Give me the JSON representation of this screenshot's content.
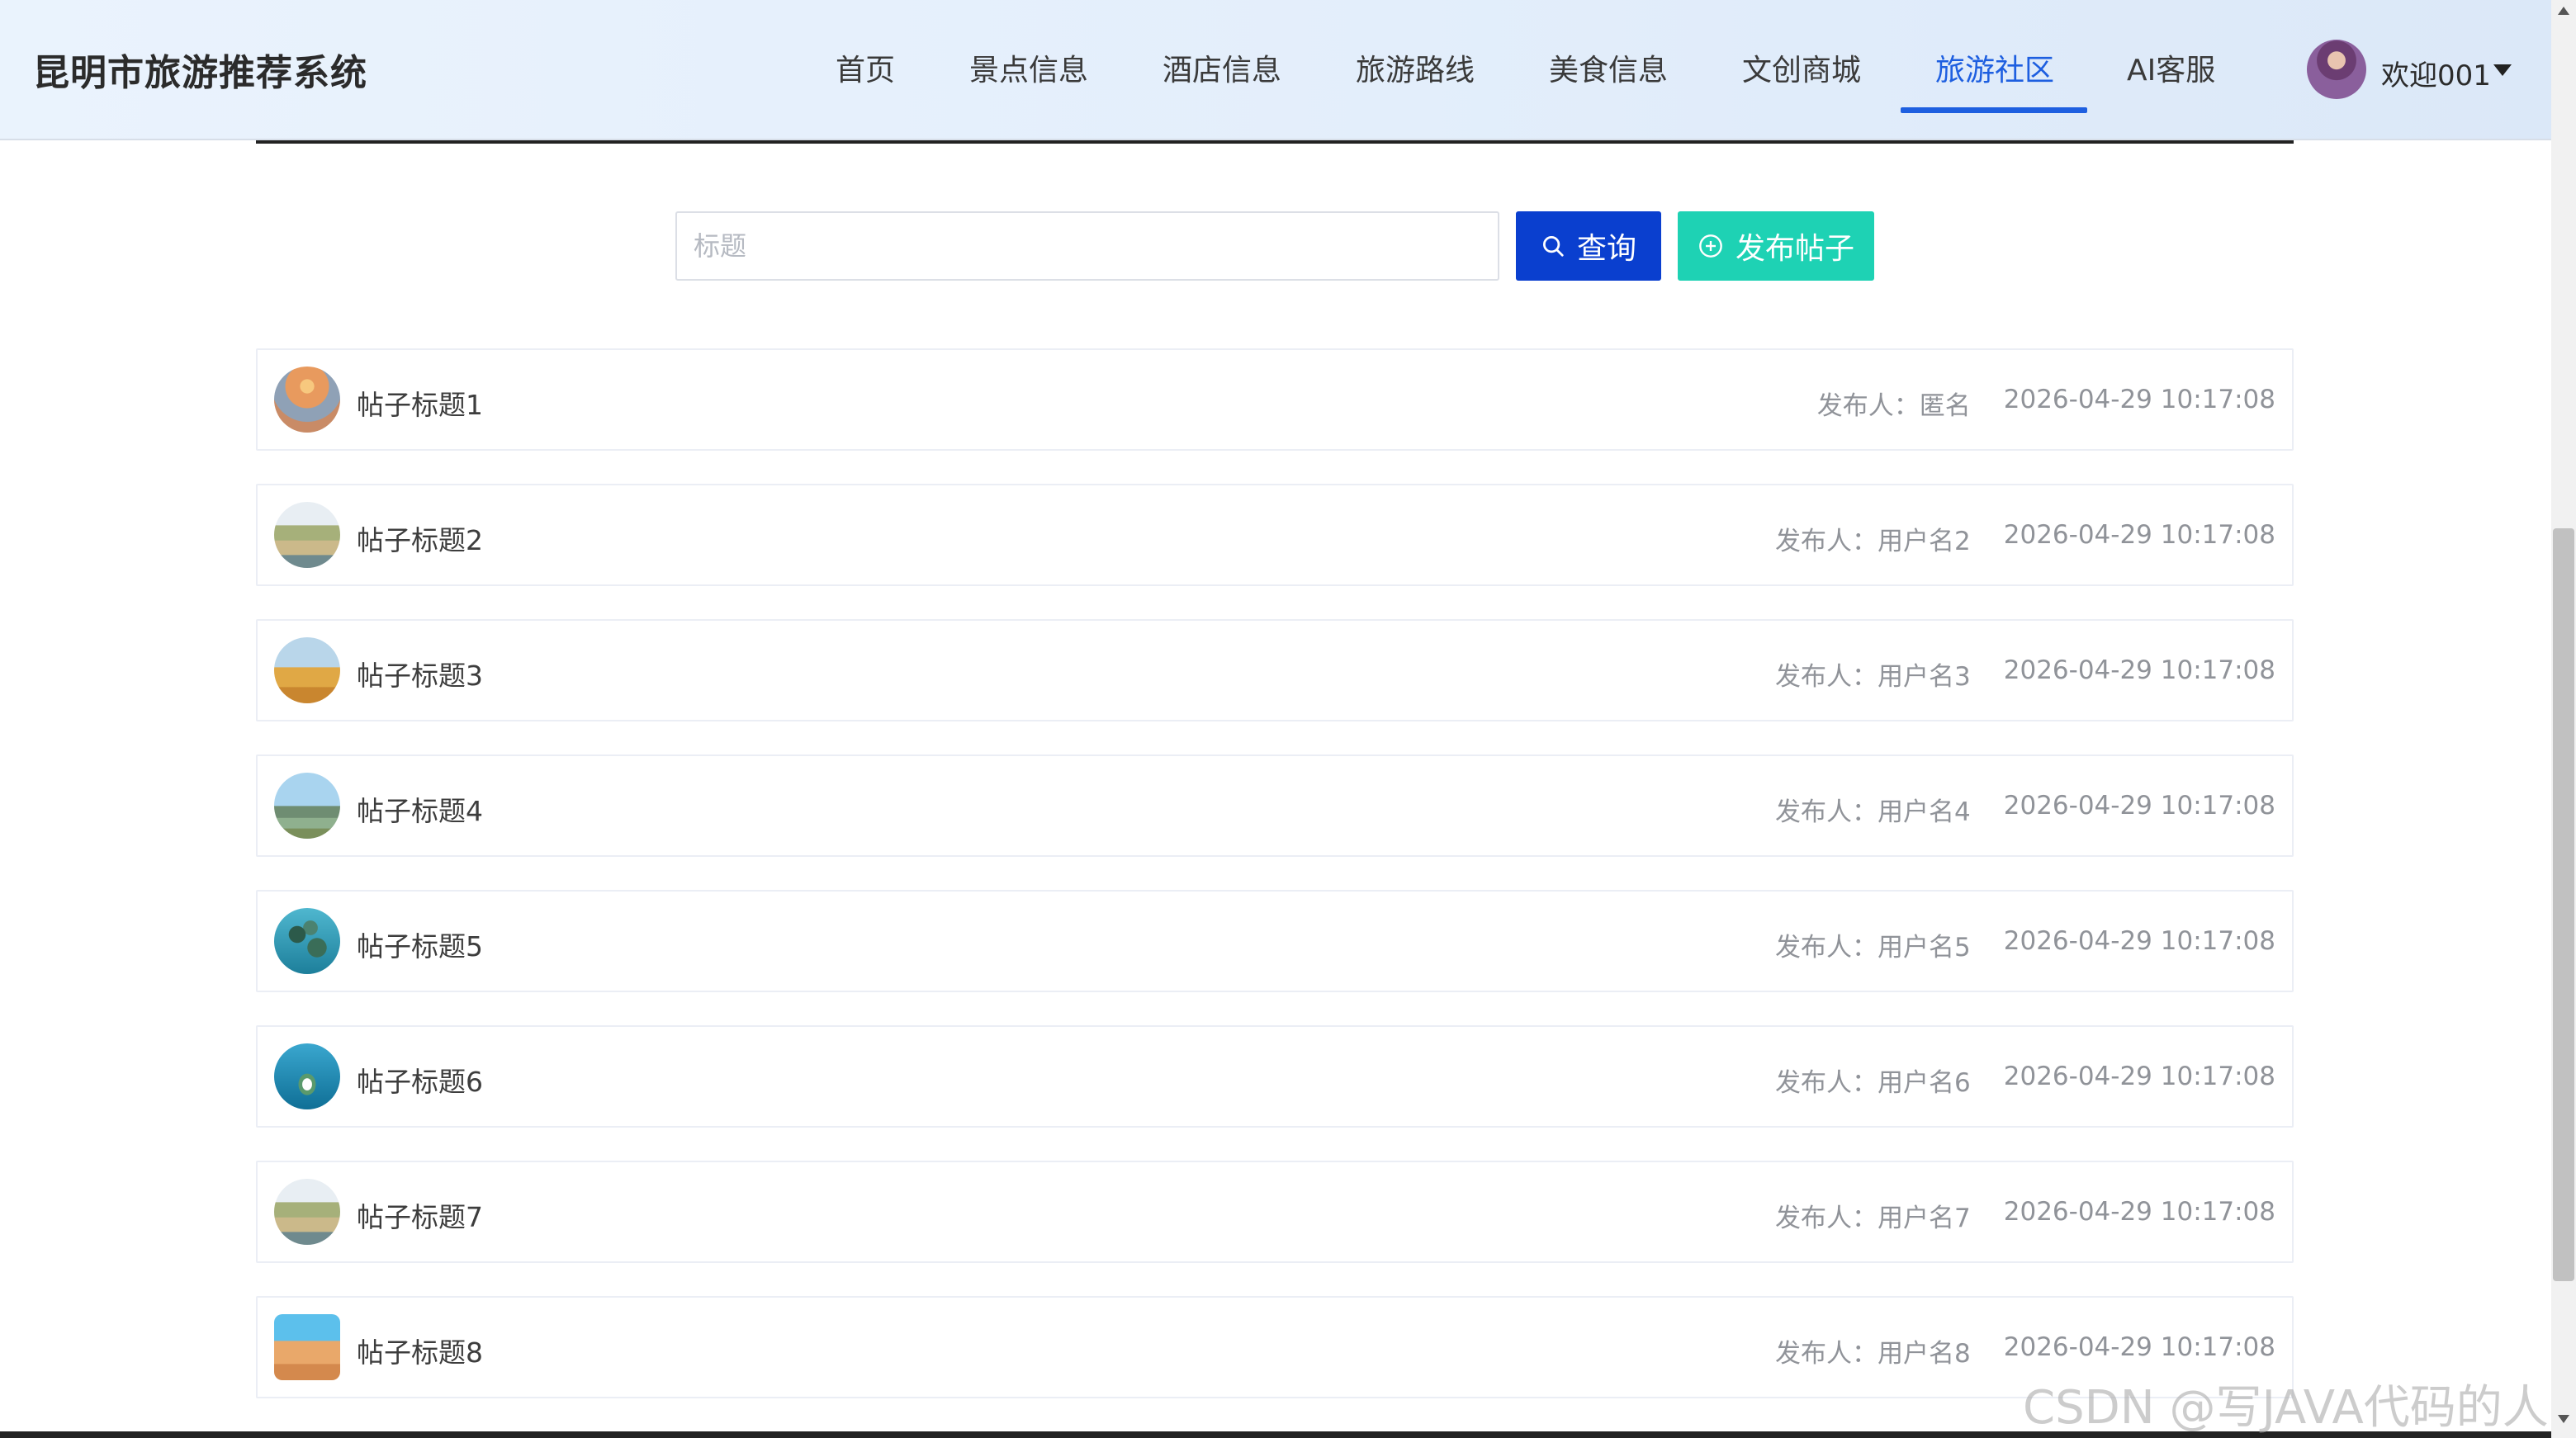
{
  "header": {
    "brand": "昆明市旅游推荐系统",
    "nav": [
      {
        "label": "首页"
      },
      {
        "label": "景点信息"
      },
      {
        "label": "酒店信息"
      },
      {
        "label": "旅游路线"
      },
      {
        "label": "美食信息"
      },
      {
        "label": "文创商城"
      },
      {
        "label": "旅游社区"
      },
      {
        "label": "AI客服"
      }
    ],
    "active_nav": "旅游社区",
    "user": {
      "welcome": "欢迎001",
      "avatar_icon": "user-avatar"
    }
  },
  "search": {
    "placeholder": "标题",
    "value": "",
    "query_label": "查询",
    "post_label": "发布帖子"
  },
  "colors": {
    "accent": "#1e5fe0",
    "query_button": "#0a3fcf",
    "post_button": "#1ed2b4"
  },
  "posts": [
    {
      "title": "帖子标题1",
      "author": "发布人：匿名",
      "time": "2026-04-29 10:17:08",
      "thumb": "sunset-beach"
    },
    {
      "title": "帖子标题2",
      "author": "发布人：用户名2",
      "time": "2026-04-29 10:17:08",
      "thumb": "wetland"
    },
    {
      "title": "帖子标题3",
      "author": "发布人：用户名3",
      "time": "2026-04-29 10:17:08",
      "thumb": "windmill-field"
    },
    {
      "title": "帖子标题4",
      "author": "发布人：用户名4",
      "time": "2026-04-29 10:17:08",
      "thumb": "mountain-lake"
    },
    {
      "title": "帖子标题5",
      "author": "发布人：用户名5",
      "time": "2026-04-29 10:17:08",
      "thumb": "coral-reef"
    },
    {
      "title": "帖子标题6",
      "author": "发布人：用户名6",
      "time": "2026-04-29 10:17:08",
      "thumb": "ocean-island"
    },
    {
      "title": "帖子标题7",
      "author": "发布人：用户名7",
      "time": "2026-04-29 10:17:08",
      "thumb": "wetland"
    },
    {
      "title": "帖子标题8",
      "author": "发布人：用户名8",
      "time": "2026-04-29 10:17:08",
      "thumb": "desert-beach"
    }
  ],
  "watermark": "CSDN @写JAVA代码的人"
}
